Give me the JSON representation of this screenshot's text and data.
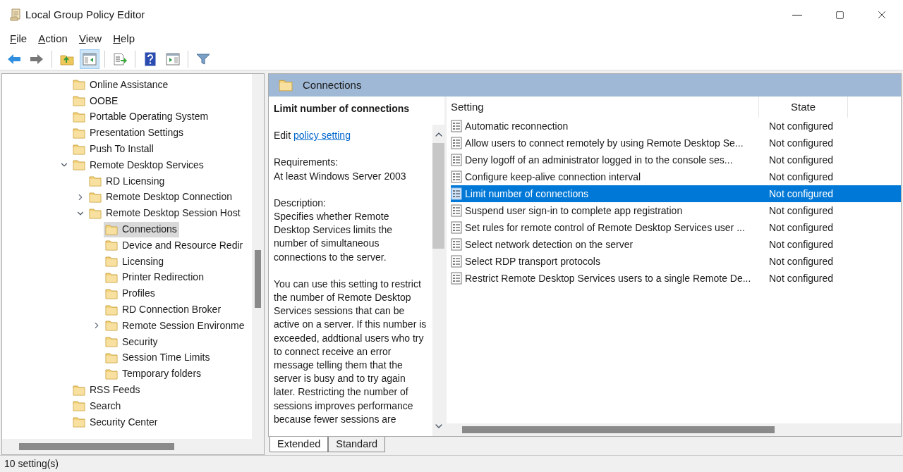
{
  "window": {
    "title": "Local Group Policy Editor"
  },
  "menu": [
    "File",
    "Action",
    "View",
    "Help"
  ],
  "toolbar": [
    {
      "kind": "back",
      "pressed": false
    },
    {
      "kind": "forward",
      "pressed": false
    },
    {
      "kind": "sep"
    },
    {
      "kind": "up",
      "pressed": false
    },
    {
      "kind": "tree",
      "pressed": true
    },
    {
      "kind": "sep"
    },
    {
      "kind": "export",
      "pressed": false
    },
    {
      "kind": "sep"
    },
    {
      "kind": "help",
      "pressed": false
    },
    {
      "kind": "pane",
      "pressed": false
    },
    {
      "kind": "sep"
    },
    {
      "kind": "filter",
      "pressed": false
    }
  ],
  "tree": [
    {
      "label": "Online Assistance",
      "selected": false
    },
    {
      "label": "OOBE",
      "selected": false
    },
    {
      "label": "Portable Operating System",
      "selected": false
    },
    {
      "label": "Presentation Settings",
      "selected": false
    },
    {
      "label": "Push To Install",
      "selected": false
    },
    {
      "label": "Remote Desktop Services",
      "selected": false,
      "expanded": true,
      "children": [
        {
          "label": "RD Licensing",
          "selected": false
        },
        {
          "label": "Remote Desktop Connection",
          "selected": false,
          "expanded": false
        },
        {
          "label": "Remote Desktop Session Host",
          "selected": false,
          "expanded": true,
          "children": [
            {
              "label": "Connections",
              "selected": true
            },
            {
              "label": "Device and Resource Redir",
              "selected": false
            },
            {
              "label": "Licensing",
              "selected": false
            },
            {
              "label": "Printer Redirection",
              "selected": false
            },
            {
              "label": "Profiles",
              "selected": false
            },
            {
              "label": "RD Connection Broker",
              "selected": false
            },
            {
              "label": "Remote Session Environme",
              "selected": false,
              "expanded": false
            },
            {
              "label": "Security",
              "selected": false
            },
            {
              "label": "Session Time Limits",
              "selected": false
            },
            {
              "label": "Temporary folders",
              "selected": false
            }
          ]
        }
      ]
    },
    {
      "label": "RSS Feeds",
      "selected": false
    },
    {
      "label": "Search",
      "selected": false
    },
    {
      "label": "Security Center",
      "selected": false
    }
  ],
  "header": {
    "title": "Connections"
  },
  "description": {
    "title": "Limit number of connections",
    "edit_prefix": "Edit",
    "link": "policy setting",
    "requirements_label": "Requirements:",
    "requirements": "At least Windows Server 2003",
    "description_label": "Description:",
    "paragraphs": [
      "Specifies whether Remote Desktop Services limits the number of simultaneous connections to the server.",
      "You can use this setting to restrict the number of Remote Desktop Services sessions that can be active on a server. If this number is exceeded, addtional users who try to connect receive an error message telling them that the server is busy and to try again later. Restricting the number of sessions improves performance because fewer sessions are"
    ]
  },
  "table": {
    "columns": [
      "Setting",
      "State"
    ],
    "rows": [
      {
        "setting": "Automatic reconnection",
        "state": "Not configured",
        "selected": false
      },
      {
        "setting": "Allow users to connect remotely by using Remote Desktop Se...",
        "state": "Not configured",
        "selected": false
      },
      {
        "setting": "Deny logoff of an administrator logged in to the console ses...",
        "state": "Not configured",
        "selected": false
      },
      {
        "setting": "Configure keep-alive connection interval",
        "state": "Not configured",
        "selected": false
      },
      {
        "setting": "Limit number of connections",
        "state": "Not configured",
        "selected": true
      },
      {
        "setting": "Suspend user sign-in to complete app registration",
        "state": "Not configured",
        "selected": false
      },
      {
        "setting": "Set rules for remote control of Remote Desktop Services user ...",
        "state": "Not configured",
        "selected": false
      },
      {
        "setting": "Select network detection on the server",
        "state": "Not configured",
        "selected": false
      },
      {
        "setting": "Select RDP transport protocols",
        "state": "Not configured",
        "selected": false
      },
      {
        "setting": "Restrict Remote Desktop Services users to a single Remote De...",
        "state": "Not configured",
        "selected": false
      }
    ]
  },
  "tabs": [
    {
      "label": "Extended",
      "selected": true
    },
    {
      "label": "Standard",
      "selected": false
    }
  ],
  "status_bar": "10 setting(s)"
}
